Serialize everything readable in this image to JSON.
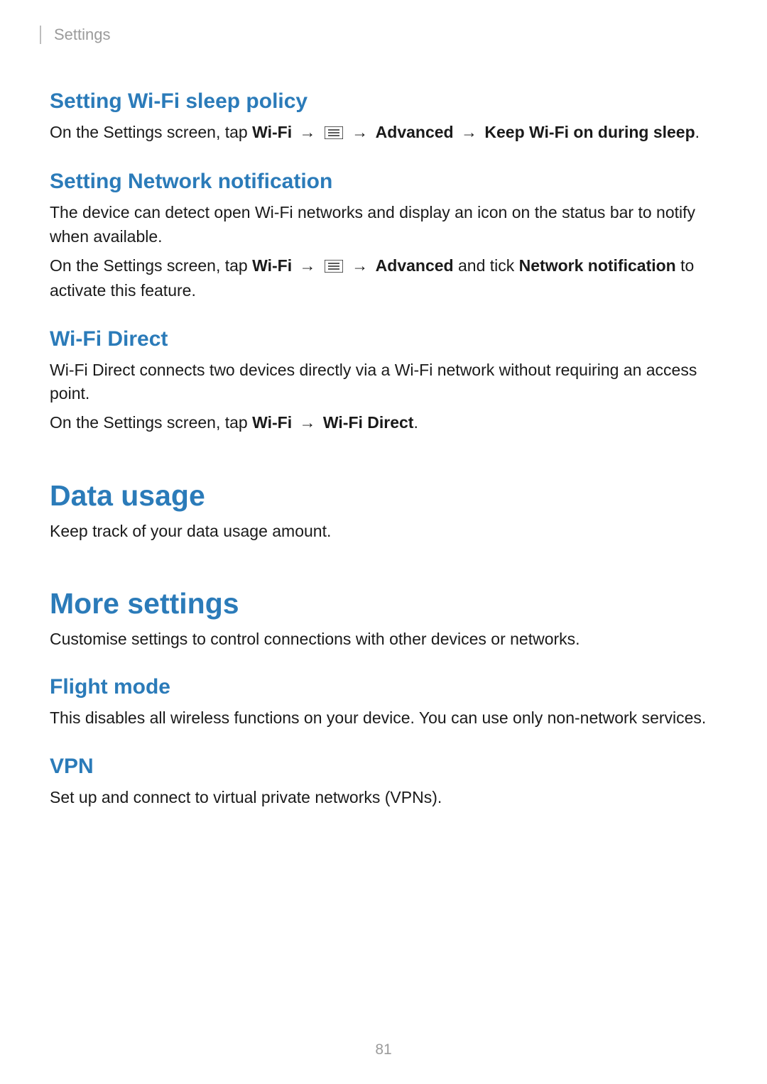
{
  "breadcrumb": "Settings",
  "pageNumber": "81",
  "sections": {
    "wifiSleep": {
      "heading": "Setting Wi-Fi sleep policy",
      "prefix": "On the Settings screen, tap ",
      "b1": "Wi-Fi",
      "arr": " → ",
      "b2": "Advanced",
      "b3": "Keep Wi-Fi on during sleep",
      "suffix": "."
    },
    "netNotif": {
      "heading": "Setting Network notification",
      "p1": "The device can detect open Wi-Fi networks and display an icon on the status bar to notify when available.",
      "p2_prefix": "On the Settings screen, tap ",
      "p2_b1": "Wi-Fi",
      "p2_arr": " → ",
      "p2_b2": "Advanced",
      "p2_mid": " and tick ",
      "p2_b3": "Network notification",
      "p2_suffix": " to activate this feature."
    },
    "wifiDirect": {
      "heading": "Wi-Fi Direct",
      "p1": "Wi-Fi Direct connects two devices directly via a Wi-Fi network without requiring an access point.",
      "p2_prefix": "On the Settings screen, tap ",
      "p2_b1": "Wi-Fi",
      "p2_arr": " → ",
      "p2_b2": "Wi-Fi Direct",
      "p2_suffix": "."
    },
    "dataUsage": {
      "heading": "Data usage",
      "p1": "Keep track of your data usage amount."
    },
    "moreSettings": {
      "heading": "More settings",
      "p1": "Customise settings to control connections with other devices or networks."
    },
    "flightMode": {
      "heading": "Flight mode",
      "p1": "This disables all wireless functions on your device. You can use only non-network services."
    },
    "vpn": {
      "heading": "VPN",
      "p1": "Set up and connect to virtual private networks (VPNs)."
    }
  }
}
